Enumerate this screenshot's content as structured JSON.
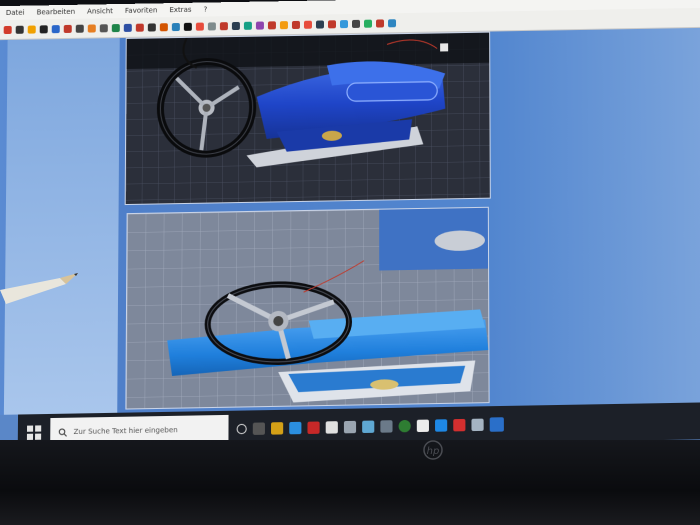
{
  "menu": [
    "Datei",
    "Bearbeiten",
    "Ansicht",
    "Favoriten",
    "Extras",
    "?"
  ],
  "taskbar": {
    "search_placeholder": "Zur Suche Text hier eingeben"
  },
  "brand_logo": "hp"
}
